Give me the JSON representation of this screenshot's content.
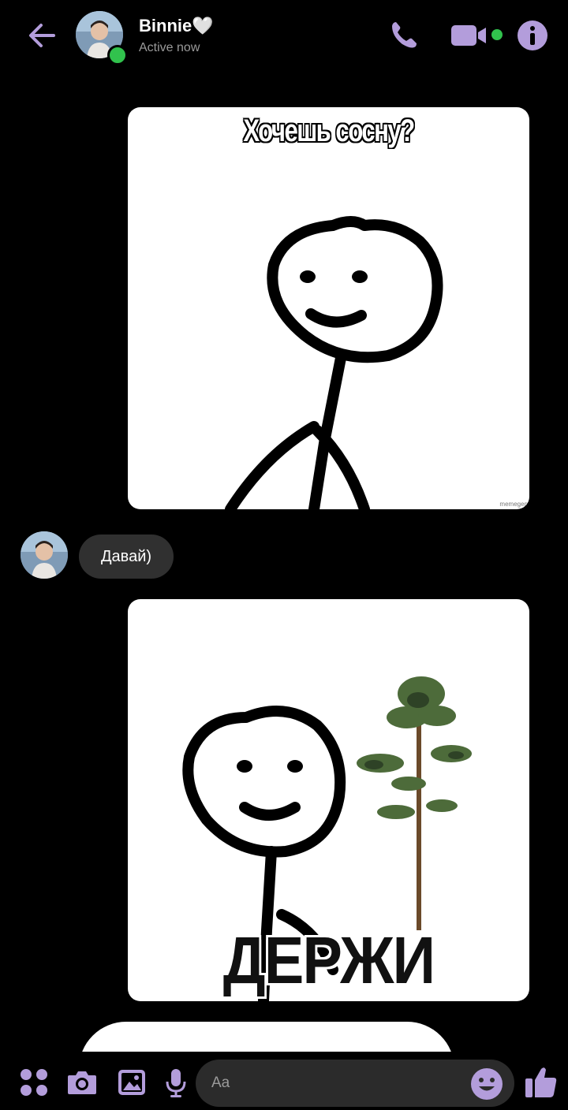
{
  "header": {
    "contact_name": "Binnie🤍",
    "status": "Active now",
    "icons": [
      "back-arrow-icon",
      "phone-icon",
      "video-icon",
      "info-icon"
    ]
  },
  "messages": [
    {
      "type": "image",
      "direction": "outgoing",
      "caption": "Хочешь сосну?",
      "watermark": "memegen"
    },
    {
      "type": "text",
      "direction": "incoming",
      "text": "Давай)"
    },
    {
      "type": "image",
      "direction": "outgoing",
      "caption": "ДЕРЖИ"
    }
  ],
  "composer": {
    "placeholder": "Aa",
    "icons": [
      "apps-icon",
      "camera-icon",
      "gallery-icon",
      "microphone-icon",
      "emoji-icon",
      "like-icon"
    ]
  },
  "colors": {
    "accent": "#b39ddb",
    "online": "#31c24d",
    "bubble_incoming": "#303030",
    "background": "#000000"
  }
}
